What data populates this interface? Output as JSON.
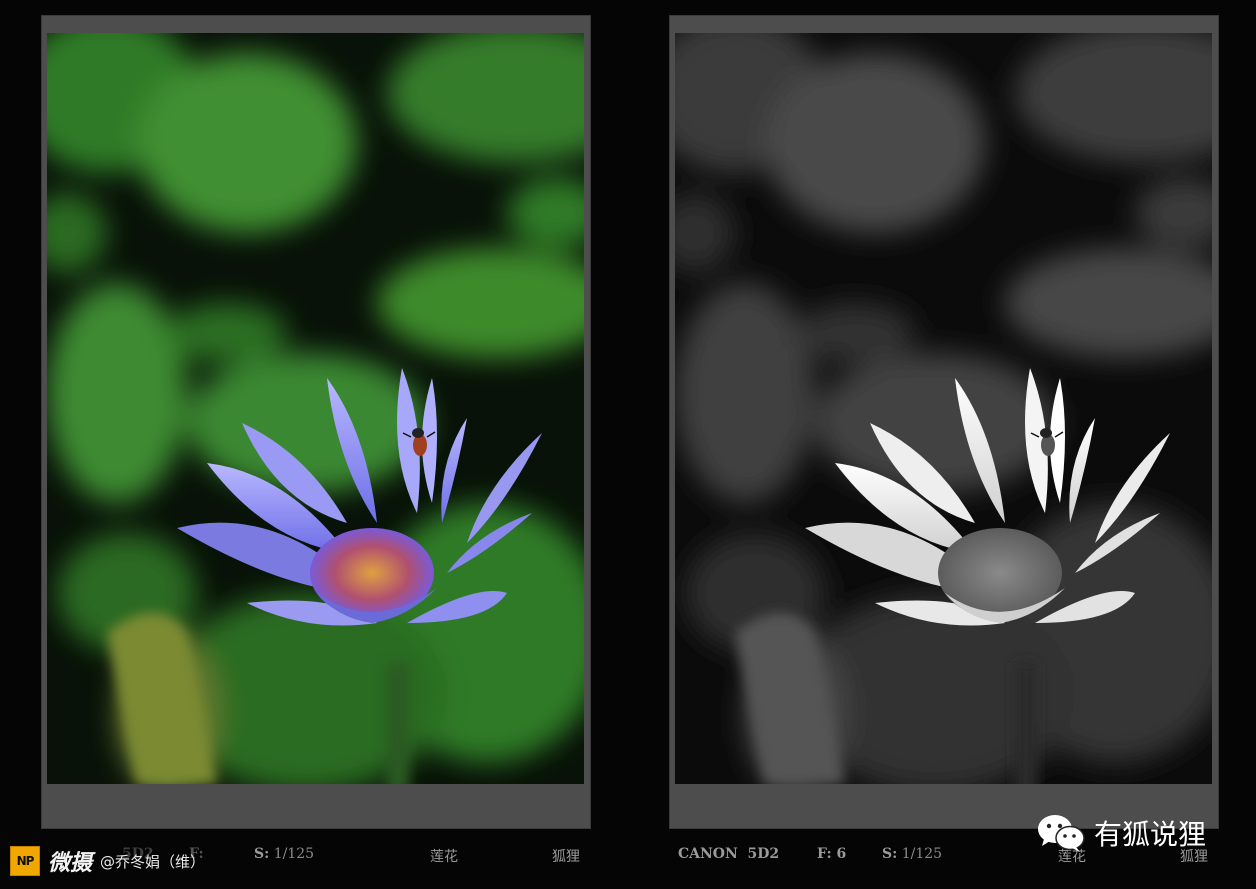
{
  "left_caption": {
    "model_partial": "5D2",
    "aperture_partial": "F:",
    "shutter_label": "S:",
    "shutter_value": "1/125",
    "title": "莲花",
    "author": "狐狸"
  },
  "right_caption": {
    "camera": "CANON  5D2",
    "aperture": "F: 6",
    "shutter_label": "S:",
    "shutter_value": "1/125",
    "title": "莲花",
    "author": "狐狸"
  },
  "watermark_weibo": {
    "logo_text": "NP",
    "platform": "微摄",
    "user": "@乔冬娟（维）"
  },
  "watermark_wechat": {
    "icon": "wechat-icon",
    "account": "有狐说狸"
  },
  "colors": {
    "background": "#050505",
    "frame": "#4d4d4d",
    "petal_color": "#8f8ff0",
    "leaf_color": "#3c8a2a"
  }
}
